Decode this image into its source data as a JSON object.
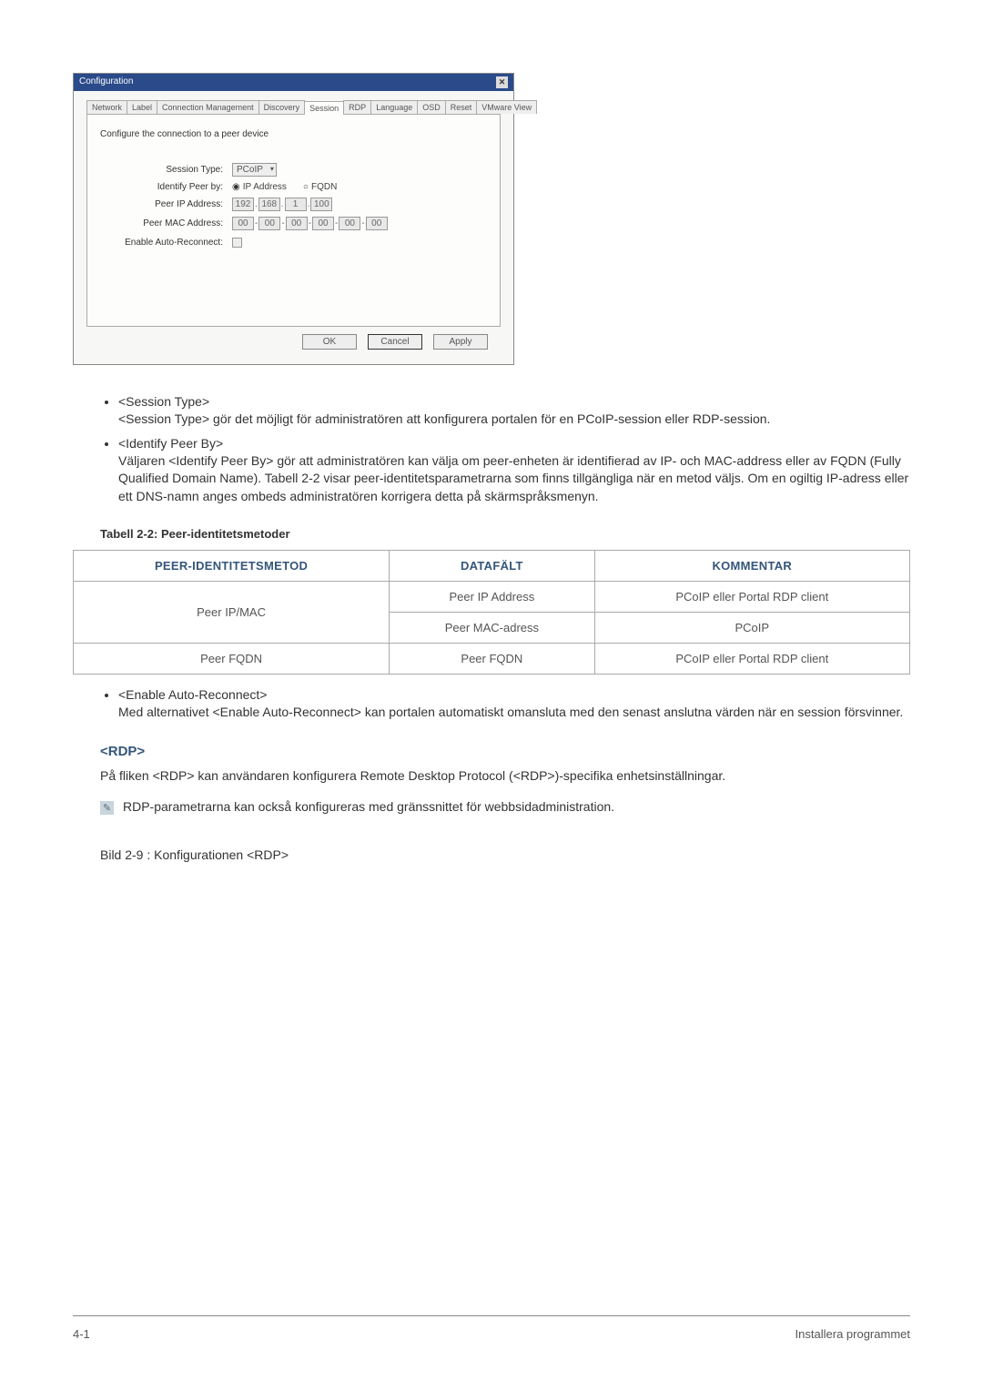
{
  "dialog": {
    "title": "Configuration",
    "tabs": [
      "Network",
      "Label",
      "Connection Management",
      "Discovery",
      "Session",
      "RDP",
      "Language",
      "OSD",
      "Reset",
      "VMware View"
    ],
    "activeTab": 4,
    "intro": "Configure the connection to a peer device",
    "labels": {
      "sessionType": "Session Type:",
      "identifyPeer": "Identify Peer by:",
      "peerIp": "Peer IP Address:",
      "peerMac": "Peer MAC Address:",
      "autoReconnect": "Enable Auto-Reconnect:"
    },
    "sessionTypeValue": "PCoIP",
    "radioIp": "IP Address",
    "radioFqdn": "FQDN",
    "ip": [
      "192",
      "168",
      "1",
      "100"
    ],
    "mac": [
      "00",
      "00",
      "00",
      "00",
      "00",
      "00"
    ],
    "buttons": {
      "ok": "OK",
      "cancel": "Cancel",
      "apply": "Apply"
    }
  },
  "list1": [
    {
      "title": "<Session Type>",
      "desc": "<Session Type> gör det möjligt för administratören att konfigurera portalen för en PCoIP-session eller RDP-session."
    },
    {
      "title": "<Identify Peer By>",
      "desc": "Väljaren <Identify Peer By> gör att administratören kan välja om peer-enheten är identifierad av IP- och MAC-address eller av FQDN (Fully Qualified Domain Name).\nTabell 2-2 visar peer-identitetsparametrarna som finns tillgängliga när en metod väljs. Om en ogiltig IP-adress eller ett DNS-namn anges ombeds administratören korrigera detta på skärmspråksmenyn."
    }
  ],
  "tableCaption": "Tabell 2-2: Peer-identitetsmetoder",
  "table": {
    "headers": [
      "PEER-IDENTITETSMETOD",
      "DATAFÄLT",
      "KOMMENTAR"
    ],
    "rows": [
      {
        "method": "Peer IP/MAC",
        "field": "Peer IP Address",
        "comment": "PCoIP eller Portal RDP client"
      },
      {
        "method": "",
        "field": "Peer MAC-adress",
        "comment": "PCoIP"
      },
      {
        "method": "Peer FQDN",
        "field": "Peer FQDN",
        "comment": "PCoIP eller Portal RDP client"
      }
    ]
  },
  "list2": [
    {
      "title": "<Enable Auto-Reconnect>",
      "desc": "Med alternativet <Enable Auto-Reconnect> kan portalen automatiskt omansluta med den senast anslutna värden när en session försvinner."
    }
  ],
  "rdp": {
    "heading": "<RDP>",
    "desc": "På fliken <RDP> kan användaren konfigurera Remote Desktop Protocol (<RDP>)-specifika enhetsinställningar.",
    "note": "RDP-parametrarna kan också konfigureras med gränssnittet för webbsidadministration."
  },
  "figureCaption": "Bild  2-9 : Konfigurationen <RDP>",
  "footer": {
    "left": "4-1",
    "right": "Installera programmet"
  }
}
